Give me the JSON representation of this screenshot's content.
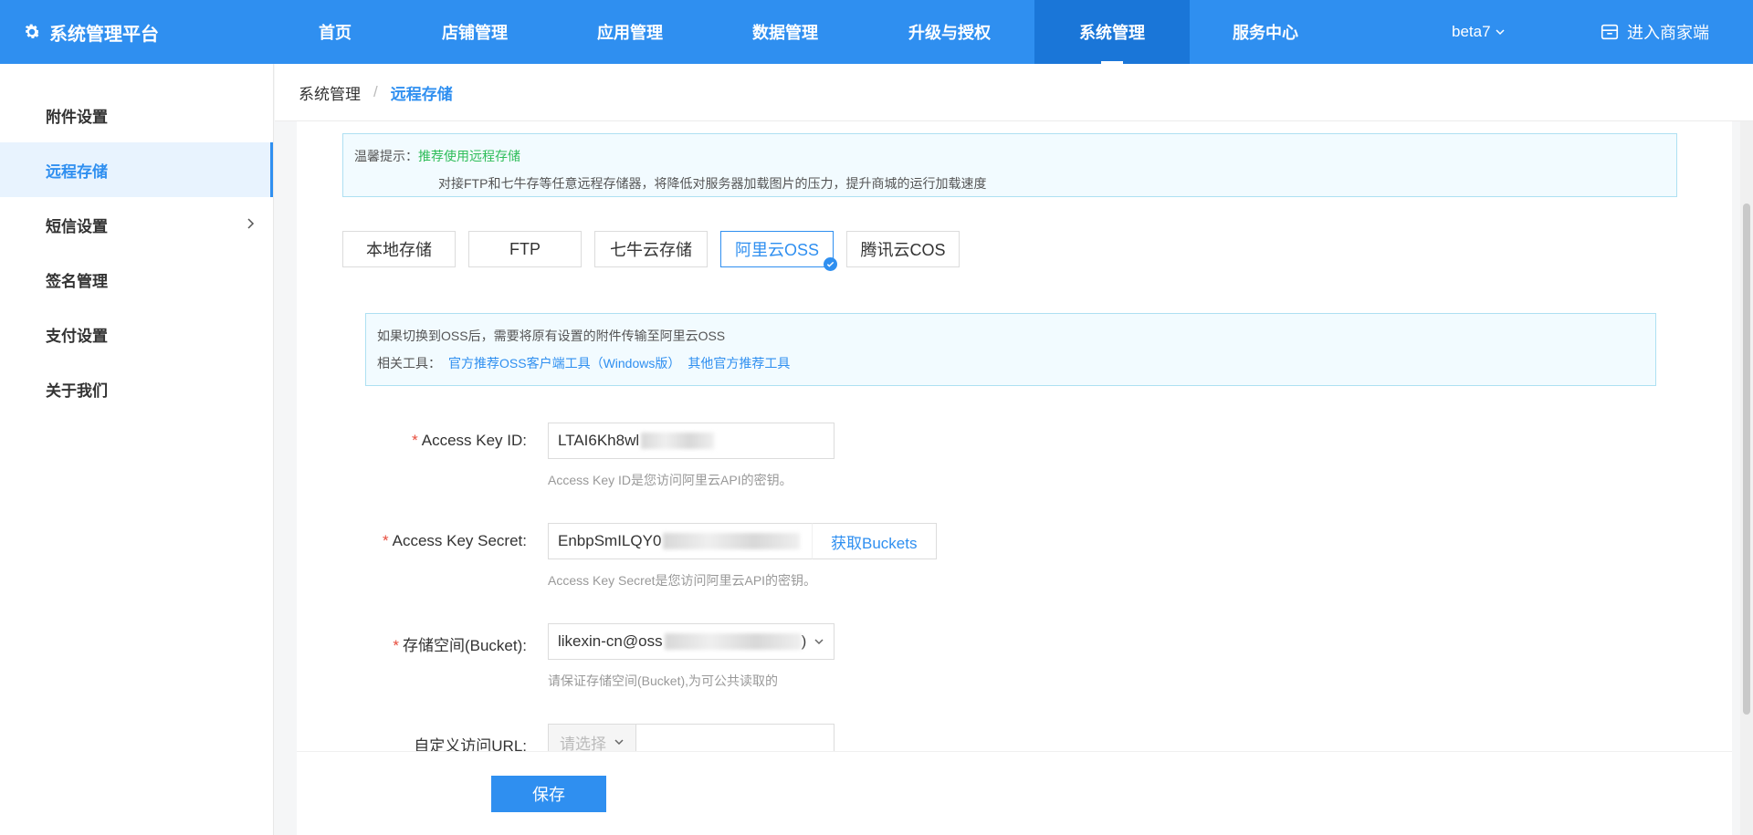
{
  "header": {
    "brand": "系统管理平台",
    "nav": [
      "首页",
      "店铺管理",
      "应用管理",
      "数据管理",
      "升级与授权",
      "系统管理",
      "服务中心"
    ],
    "active_nav": "系统管理",
    "user": "beta7",
    "merchant_link": "进入商家端"
  },
  "sidebar": {
    "items": [
      {
        "label": "附件设置"
      },
      {
        "label": "远程存储"
      },
      {
        "label": "短信设置"
      },
      {
        "label": "签名管理"
      },
      {
        "label": "支付设置"
      },
      {
        "label": "关于我们"
      }
    ],
    "active": "远程存储"
  },
  "breadcrumb": {
    "parent": "系统管理",
    "separator": "/",
    "current": "远程存储"
  },
  "tip": {
    "label": "温馨提示：",
    "highlight": "推荐使用远程存储",
    "detail": "对接FTP和七牛存等任意远程存储器，将降低对服务器加载图片的压力，提升商城的运行加载速度"
  },
  "storage_tabs": {
    "items": [
      "本地存储",
      "FTP",
      "七牛云存储",
      "阿里云OSS",
      "腾讯云COS"
    ],
    "active": "阿里云OSS"
  },
  "oss_notice": {
    "line1": "如果切换到OSS后，需要将原有设置的附件传输至阿里云OSS",
    "tools_label": "相关工具：",
    "tool1": "官方推荐OSS客户端工具（Windows版）",
    "tool2": "其他官方推荐工具"
  },
  "form": {
    "access_key_id": {
      "required_mark": "*",
      "label": "Access Key ID:",
      "value": "LTAI6Kh8wl",
      "hint": "Access Key ID是您访问阿里云API的密钥。"
    },
    "access_key_secret": {
      "required_mark": "*",
      "label": "Access Key Secret:",
      "value": "EnbpSmILQY0",
      "button": "获取Buckets",
      "hint": "Access Key Secret是您访问阿里云API的密钥。"
    },
    "bucket": {
      "required_mark": "*",
      "label": "存储空间(Bucket):",
      "value": "likexin-cn@oss",
      "suffix": ")",
      "hint": "请保证存储空间(Bucket),为可公共读取的"
    },
    "custom_url": {
      "label": "自定义访问URL:",
      "select_placeholder": "请选择"
    }
  },
  "footer": {
    "save_label": "保存"
  },
  "colors": {
    "primary": "#2f8ff0",
    "header_bg": "#2f8ff0",
    "active_nav_bg": "#1a76d8",
    "tip_highlight": "#2ebd59",
    "required": "#e74c3c"
  },
  "icons": {
    "brand": "gear-icon",
    "user_dropdown": "chevron-down-icon",
    "merchant": "store-icon",
    "sidebar_expand": "chevron-right-icon",
    "tab_selected": "check-icon",
    "select_dropdown": "chevron-down-icon"
  }
}
